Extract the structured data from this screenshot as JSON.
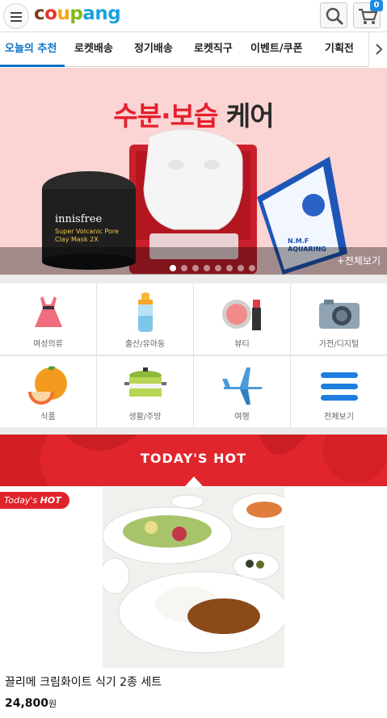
{
  "header": {
    "logo_text": "coupang",
    "cart_count": "0",
    "icons": [
      "menu-icon",
      "search-icon",
      "cart-icon"
    ]
  },
  "tabs": [
    {
      "label": "오늘의 추천",
      "active": true
    },
    {
      "label": "로켓배송"
    },
    {
      "label": "정기배송"
    },
    {
      "label": "로켓직구"
    },
    {
      "label": "이벤트/쿠폰"
    },
    {
      "label": "기획전"
    }
  ],
  "banner": {
    "headline_red": "수분·보습",
    "headline_dark": "케어",
    "product_text_1": "innisfree",
    "product_text_2": "Super Volcanic Pore Clay Mask 2X",
    "product_text_3": "N.M.F AQUARING",
    "more_label": "+전체보기",
    "slide_count": 8,
    "active_slide": 1
  },
  "categories": [
    {
      "label": "여성의류",
      "icon": "dress-icon"
    },
    {
      "label": "출산/유아동",
      "icon": "baby-bottle-icon"
    },
    {
      "label": "뷰티",
      "icon": "cosmetics-icon"
    },
    {
      "label": "가전/디지털",
      "icon": "camera-icon"
    },
    {
      "label": "식품",
      "icon": "orange-icon"
    },
    {
      "label": "생활/주방",
      "icon": "pot-icon"
    },
    {
      "label": "여행",
      "icon": "airplane-icon"
    },
    {
      "label": "전체보기",
      "icon": "hamburger-icon"
    }
  ],
  "todays_hot": {
    "title": "TODAY'S HOT",
    "badge_prefix": "Today's",
    "badge_strong": "HOT",
    "product": {
      "name": "끌리메 크림화이트 식기 2종 세트",
      "price": "24,800",
      "currency": "원"
    }
  },
  "colors": {
    "accent_blue": "#0a73c8",
    "hot_red": "#e0262c",
    "banner_pink": "#fbd4d4"
  }
}
